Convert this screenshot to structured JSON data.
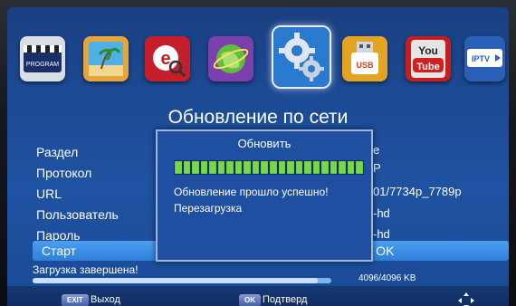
{
  "apps": [
    {
      "name": "program",
      "label": "PROGRAM",
      "color": "#2b4f9e"
    },
    {
      "name": "media",
      "label": "",
      "color": "#e2a030"
    },
    {
      "name": "browser",
      "label": "",
      "color": "#c0202a"
    },
    {
      "name": "network",
      "label": "",
      "color": "#7a3fa8"
    },
    {
      "name": "settings",
      "label": "",
      "color": "#2f80d0",
      "selected": true
    },
    {
      "name": "usb",
      "label": "USB",
      "color": "#e0a020"
    },
    {
      "name": "youtube",
      "label": "You",
      "label2": "Tube",
      "color": "#c81e1e"
    },
    {
      "name": "iptv",
      "label": "IPTV",
      "color": "#2a5fb8"
    }
  ],
  "page": {
    "title": "Обновление по сети"
  },
  "menu": [
    "Раздел",
    "Протокол",
    "URL",
    "Пользователь",
    "Пароль",
    "Старт"
  ],
  "values": [
    "е",
    "Р",
    "01/7734p_7789p",
    "-hd",
    "-hd"
  ],
  "start_value": "ь OK",
  "dialog": {
    "title": "Обновить",
    "segments": 22,
    "message": "Обновление прошло успешно!",
    "message2": "Перезагрузка"
  },
  "status": {
    "text": "Загрузка завершена!",
    "progress": "4096/4096 KB",
    "fraction": 0.955
  },
  "help": {
    "exit_key": "EXIT",
    "exit_label": "Выход",
    "ok_key": "OK",
    "ok_label": "Подтверд"
  }
}
